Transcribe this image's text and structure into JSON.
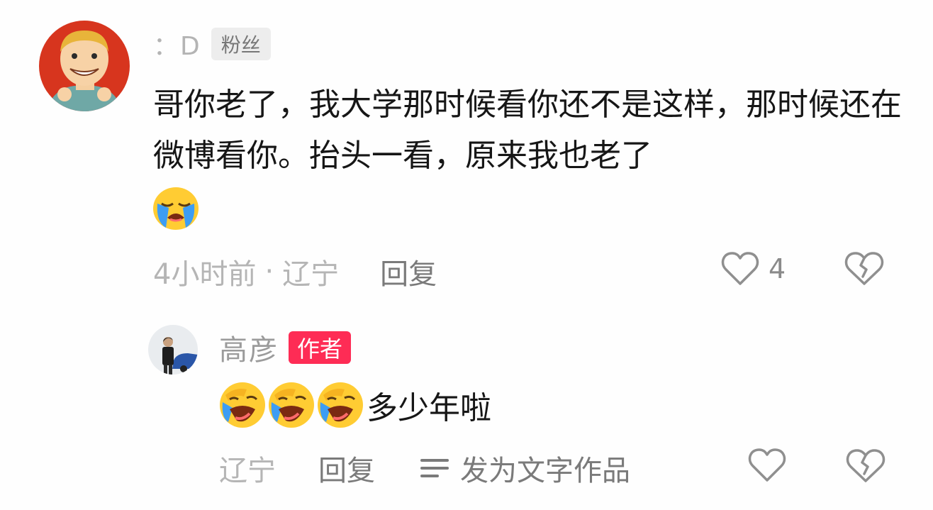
{
  "comment": {
    "username": "：D",
    "fan_badge": "粉丝",
    "text": "哥你老了，我大学那时候看你还不是这样，那时候还在微博看你。抬头一看，原来我也老了",
    "emoji": "loudly-crying-face",
    "time": "4小时前",
    "separator": "·",
    "location": "辽宁",
    "reply_label": "回复",
    "like_count": "4"
  },
  "reply": {
    "username": "高彦",
    "author_badge": "作者",
    "emoji": "rolling-on-the-floor-laughing",
    "text": "多少年啦",
    "location": "辽宁",
    "reply_label": "回复",
    "publish_label": "发为文字作品"
  },
  "colors": {
    "author_badge": "#fe2c55",
    "muted_text": "#b5b5b5",
    "action_text": "#7a7a7a",
    "body_text": "#161616"
  }
}
